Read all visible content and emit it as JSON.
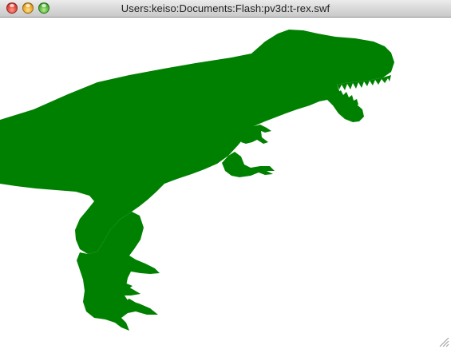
{
  "window": {
    "title": "Users:keiso:Documents:Flash:pv3d:t-rex.swf",
    "buttons": {
      "close_icon": "close-icon",
      "minimize_icon": "minimize-icon",
      "zoom_icon": "zoom-icon"
    }
  },
  "content": {
    "subject": "t-rex-silhouette",
    "fill_color": "#008000",
    "background_color": "#ffffff"
  },
  "colors": {
    "dino": "#008000",
    "titlebar_top": "#ececec",
    "titlebar_bottom": "#c9c9c9"
  }
}
